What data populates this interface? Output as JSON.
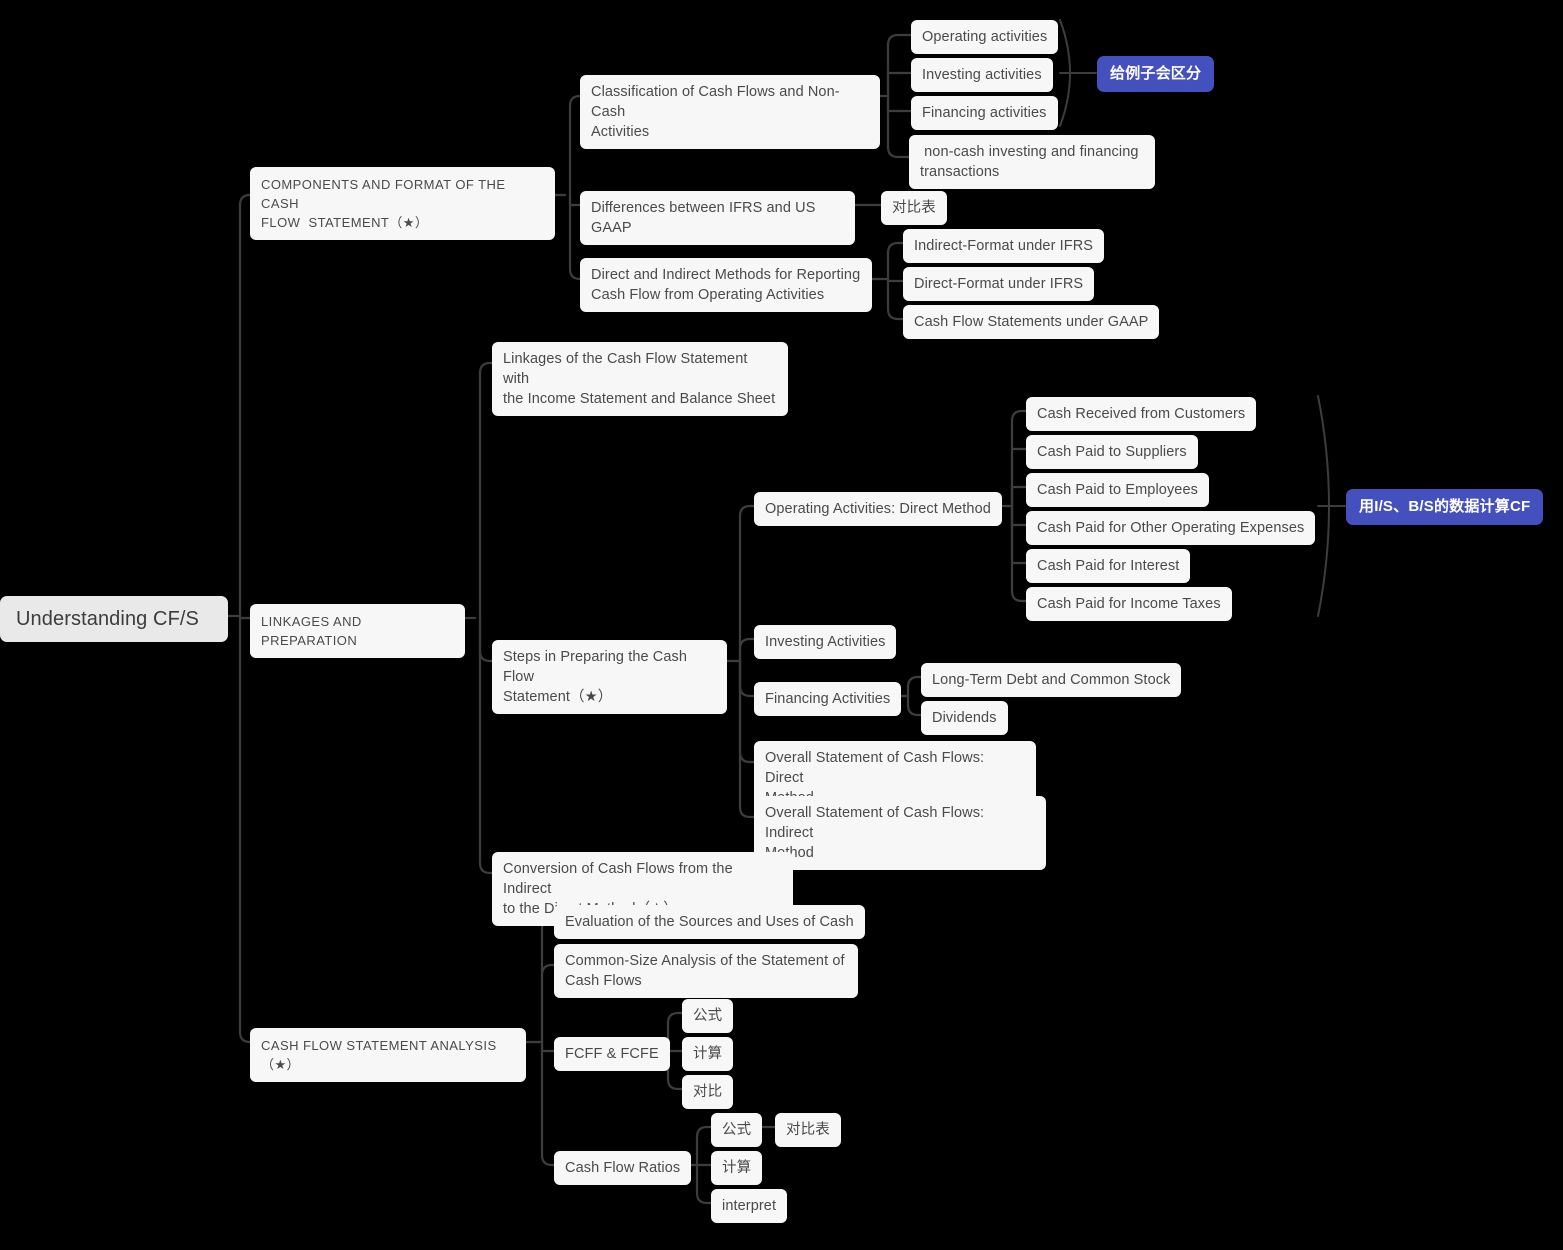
{
  "title": "Understanding CF/S",
  "theme": {
    "background": "#000000",
    "node_fill": "#f7f7f7",
    "root_fill": "#e9e9e9",
    "node_text": "#4a4a4a",
    "badge_fill": "#4550bf",
    "badge_text": "#ffffff",
    "connector": "#3d3d3d"
  },
  "root": {
    "label": "Understanding CF/S"
  },
  "branches": [
    {
      "label": "COMPONENTS AND FORMAT OF THE CASH\nFLOW  STATEMENT（★）"
    },
    {
      "label": "LINKAGES AND PREPARATION"
    },
    {
      "label": "CASH FLOW STATEMENT ANALYSIS（★）"
    }
  ],
  "nodes": {
    "classification": "Classification of Cash Flows and Non-Cash\nActivities",
    "operating_activities": "Operating activities",
    "investing_activities": "Investing activities",
    "financing_activities": "Financing activities",
    "non_cash": " non-cash investing and financing\ntransactions",
    "badge_examples": "给例子会区分",
    "differences_ifrs_gaap": "Differences between IFRS and US GAAP",
    "comparison_table_1": "对比表",
    "direct_indirect_methods": "Direct and Indirect Methods for Reporting\nCash Flow from Operating Activities",
    "indirect_format_ifrs": "Indirect-Format under IFRS",
    "direct_format_ifrs": "Direct-Format under IFRS",
    "cfs_under_gaap": "Cash Flow Statements under GAAP",
    "linkages_cfs": "Linkages of the Cash Flow Statement with\nthe Income Statement and Balance Sheet",
    "steps_preparing": "Steps in Preparing the Cash Flow\nStatement（★）",
    "operating_direct_method": "Operating Activities: Direct Method",
    "cash_received_customers": "Cash Received from Customers",
    "cash_paid_suppliers": "Cash Paid to Suppliers",
    "cash_paid_employees": "Cash Paid to Employees",
    "cash_paid_other_opex": "Cash Paid for Other Operating Expenses",
    "cash_paid_interest": "Cash Paid for Interest",
    "cash_paid_income_taxes": "Cash Paid for Income Taxes",
    "badge_compute_cf": "用I/S、B/S的数据计算CF",
    "investing_activities_step": "Investing Activities",
    "financing_activities_step": "Financing Activities",
    "long_term_debt": "Long-Term Debt and Common Stock",
    "dividends": "Dividends",
    "overall_direct": "Overall Statement of Cash Flows: Direct\nMethod",
    "overall_indirect": "Overall Statement of Cash Flows: Indirect\nMethod",
    "conversion": "Conversion of Cash Flows from the Indirect\nto the Direct Method（★）",
    "evaluation_sources": "Evaluation of the Sources and Uses of Cash",
    "common_size": "Common-Size Analysis of the Statement of\nCash Flows",
    "fcff_fcfe": "FCFF & FCFE",
    "fcff_formula": "公式",
    "fcff_calc": "计算",
    "fcff_compare": "对比",
    "cash_flow_ratios": "Cash Flow Ratios",
    "ratios_formula": "公式",
    "ratios_comparison_table": "对比表",
    "ratios_calc": "计算",
    "ratios_interpret": "interpret"
  }
}
